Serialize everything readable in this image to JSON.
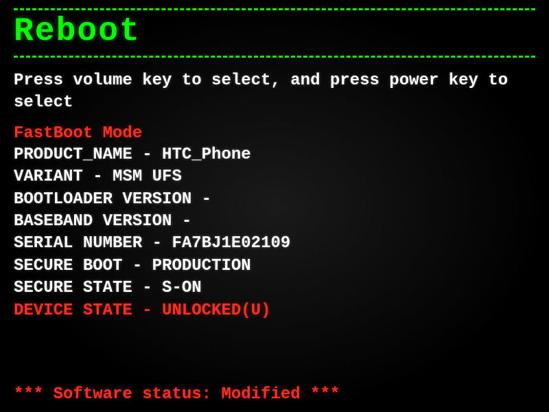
{
  "title": "Reboot",
  "instruction": "Press volume key to select, and press power key to select",
  "mode_label": "FastBoot Mode",
  "info": {
    "product_name": {
      "label": "PRODUCT_NAME",
      "value": "HTC_Phone"
    },
    "variant": {
      "label": "VARIANT",
      "value": "MSM UFS"
    },
    "bootloader_version": {
      "label": "BOOTLOADER VERSION",
      "value": ""
    },
    "baseband_version": {
      "label": "BASEBAND VERSION",
      "value": ""
    },
    "serial_number": {
      "label": "SERIAL NUMBER",
      "value": "FA7BJ1E02109"
    },
    "secure_boot": {
      "label": "SECURE BOOT",
      "value": "PRODUCTION"
    },
    "secure_state": {
      "label": "SECURE STATE",
      "value": "S-ON"
    },
    "device_state": {
      "label": "DEVICE STATE",
      "value": "UNLOCKED(U)"
    }
  },
  "software_status": "*** Software status: Modified ***",
  "colors": {
    "green": "#00ff00",
    "red": "#ff3020",
    "white": "#ffffff",
    "background": "#0a0a0a"
  }
}
